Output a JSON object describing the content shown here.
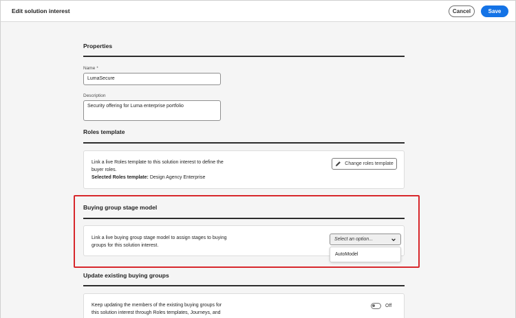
{
  "header": {
    "title": "Edit solution interest",
    "cancel_label": "Cancel",
    "save_label": "Save",
    "accent": "#1473e6"
  },
  "properties": {
    "section_title": "Properties",
    "name_label": "Name",
    "required_mark": "*",
    "name_value": "LumaSecure",
    "description_label": "Description",
    "description_value": "Security offering for Luma enterprise portfolio"
  },
  "roles_template": {
    "section_title": "Roles template",
    "text_line1": "Link a live Roles template to this solution interest to define the",
    "text_line2": "buyer roles.",
    "selected_label": "Selected Roles template:",
    "selected_value": "Design Agency Enterprise",
    "change_button": "Change roles template",
    "change_icon": "pencil-icon"
  },
  "buying_group_stage_model": {
    "section_title": "Buying group stage model",
    "text_line1": "Link a live buying group stage model to assign stages to buying",
    "text_line2": "groups for this solution interest.",
    "select_placeholder": "Select an option...",
    "options": [
      "AutoModel"
    ],
    "highlight_color": "#d7262a"
  },
  "update_buying_groups": {
    "section_title": "Update existing buying groups",
    "text_line1": "Keep updating the members of the existing buying groups for",
    "text_line2": "this solution interest through Roles templates, Journeys, and",
    "toggle_state": "Off"
  }
}
